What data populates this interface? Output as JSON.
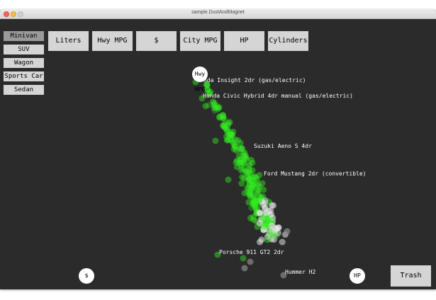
{
  "window": {
    "title": "sample.DustAndMagnet"
  },
  "presets": [
    {
      "label": "Minivan",
      "active": true
    },
    {
      "label": "SUV",
      "active": false
    },
    {
      "label": "Wagon",
      "active": false
    },
    {
      "label": "Sports Car",
      "active": false
    },
    {
      "label": "Sedan",
      "active": false
    }
  ],
  "dimensions": [
    {
      "label": "Liters"
    },
    {
      "label": "Hwy MPG"
    },
    {
      "label": "$"
    },
    {
      "label": "City MPG"
    },
    {
      "label": "HP"
    },
    {
      "label": "Cylinders"
    }
  ],
  "magnets": [
    {
      "label": "Hwy MPG"
    },
    {
      "label": "$"
    },
    {
      "label": "HP"
    }
  ],
  "car_labels": [
    {
      "text": "nda Insight 2dr (gas/electric)"
    },
    {
      "text": "Honda Civic Hybrid 4dr manual (gas/electric)"
    },
    {
      "text": "Suzuki Aeno S 4dr"
    },
    {
      "text": "Ford Mustang 2dr (convertible)"
    },
    {
      "text": "Porsche 911 GT2 2dr"
    },
    {
      "text": "Hummer H2"
    }
  ],
  "trash": {
    "label": "Trash"
  },
  "colors": {
    "background": "#2b2b2b",
    "button": "#d5d5d5",
    "button_active": "#9a9a9a",
    "dust_green": "#33ee22",
    "dust_white": "#e6e6e6",
    "dust_gray": "#8a8a8a"
  }
}
